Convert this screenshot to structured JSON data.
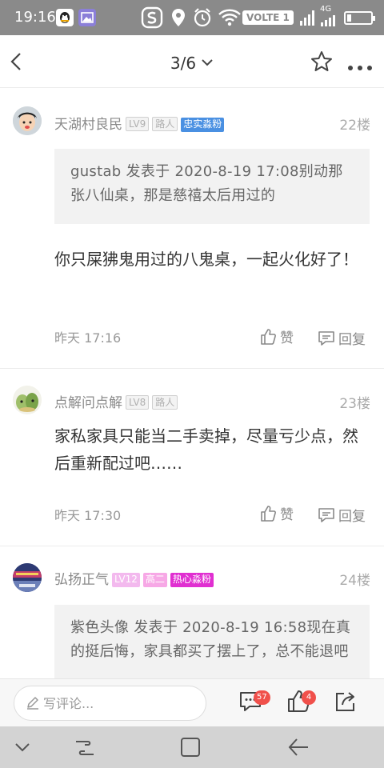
{
  "status_bar": {
    "time": "19:16",
    "volte": "VOLTE 1",
    "network": "4G",
    "battery_level": 0.18
  },
  "top_nav": {
    "pager": "3/6"
  },
  "comments": [
    {
      "user": "天湖村良民",
      "badges": [
        {
          "text": "LV9",
          "style": "grey"
        },
        {
          "text": "路人",
          "style": "grey"
        },
        {
          "text": "忠实淼粉",
          "style": "blue"
        }
      ],
      "floor": "22楼",
      "quote": "gustab 发表于 2020-8-19 17:08别动那张八仙桌，那是慈禧太后用过的",
      "content": "你只屎狒鬼用过的八鬼桌，一起火化好了！",
      "time": "昨天 17:16",
      "like_label": "赞",
      "reply_label": "回复"
    },
    {
      "user": "点解问点解",
      "badges": [
        {
          "text": "LV8",
          "style": "grey"
        },
        {
          "text": "路人",
          "style": "grey"
        }
      ],
      "floor": "23楼",
      "quote": "",
      "content": "家私家具只能当二手卖掉，尽量亏少点，然后重新配过吧……",
      "time": "昨天 17:30",
      "like_label": "赞",
      "reply_label": "回复"
    },
    {
      "user": "弘扬正气",
      "badges": [
        {
          "text": "LV12",
          "style": "pinklight"
        },
        {
          "text": "高二",
          "style": "pink"
        },
        {
          "text": "热心淼粉",
          "style": "magenta"
        }
      ],
      "floor": "24楼",
      "quote": "紫色头像 发表于 2020-8-19 16:58现在真的挺后悔，家具都买了摆上了，总不能退吧",
      "content": "",
      "time": "",
      "like_label": "",
      "reply_label": ""
    }
  ],
  "bottom_bar": {
    "comment_placeholder": "写评论...",
    "comment_count": "57",
    "like_count": "4"
  },
  "colors": {
    "status_bar_bg": "#8a8a8a",
    "accent_blue": "#4a90e2",
    "badge_magenta": "#e02fd1",
    "notification_red": "#f0504b"
  }
}
